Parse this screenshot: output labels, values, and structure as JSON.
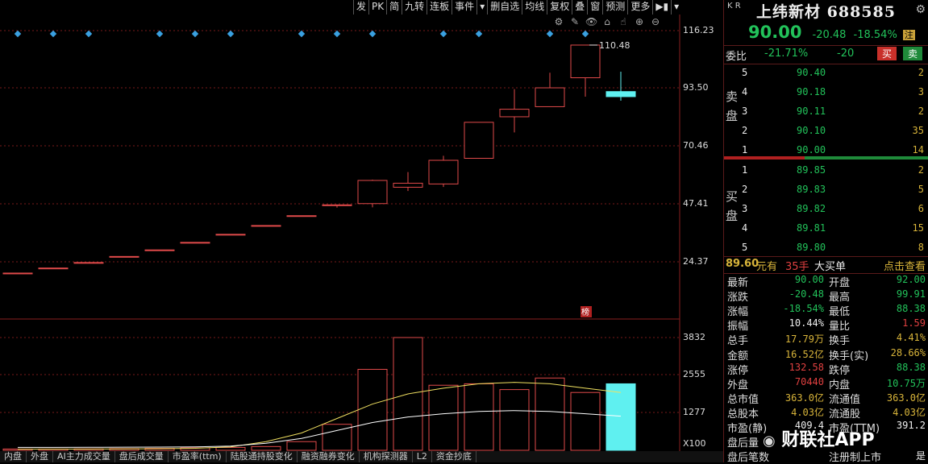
{
  "toolbar": [
    "发",
    "PK",
    "简",
    "九转",
    "连板",
    "事件",
    "▾",
    "删自选",
    "均线",
    "复权",
    "叠",
    "窗",
    "预测",
    "更多",
    "▶▮",
    "▾"
  ],
  "chart_icons": [
    "⚙",
    "✎",
    "👁",
    "⌂",
    "☝",
    "⊕",
    "⊖"
  ],
  "chart_data": {
    "type": "candlestick",
    "y_ticks_price": [
      "116.23",
      "93.50",
      "70.46",
      "47.41",
      "24.37"
    ],
    "y_ticks_volume": [
      "3832",
      "2555",
      "1277",
      "X100"
    ],
    "high_annotation": "110.48",
    "rank_badge": "榜",
    "candles": [
      {
        "o": 19.9,
        "c": 19.9,
        "h": 19.9,
        "l": 19.9
      },
      {
        "o": 21.9,
        "c": 21.9,
        "h": 21.9,
        "l": 21.9
      },
      {
        "o": 24.1,
        "c": 24.1,
        "h": 24.1,
        "l": 24.1
      },
      {
        "o": 26.5,
        "c": 26.5,
        "h": 26.5,
        "l": 26.5
      },
      {
        "o": 29.1,
        "c": 29.1,
        "h": 29.1,
        "l": 29.1
      },
      {
        "o": 32.1,
        "c": 32.1,
        "h": 32.1,
        "l": 32.1
      },
      {
        "o": 35.3,
        "c": 35.3,
        "h": 35.3,
        "l": 35.3
      },
      {
        "o": 38.8,
        "c": 38.8,
        "h": 38.8,
        "l": 38.8
      },
      {
        "o": 42.7,
        "c": 42.7,
        "h": 42.7,
        "l": 42.7
      },
      {
        "o": 46.9,
        "c": 47.0,
        "h": 47.0,
        "l": 45.9
      },
      {
        "o": 47.5,
        "c": 56.7,
        "h": 57.0,
        "l": 46.0
      },
      {
        "o": 54.0,
        "c": 55.6,
        "h": 60.0,
        "l": 52.5
      },
      {
        "o": 55.3,
        "c": 64.7,
        "h": 66.5,
        "l": 54.1
      },
      {
        "o": 65.5,
        "c": 79.8,
        "h": 79.8,
        "l": 65.5
      },
      {
        "o": 82.0,
        "c": 85.0,
        "h": 93.0,
        "l": 75.8
      },
      {
        "o": 86.0,
        "c": 93.5,
        "h": 99.5,
        "l": 86.0
      },
      {
        "o": 97.5,
        "c": 110.48,
        "h": 110.48,
        "l": 90.0
      },
      {
        "o": 92.0,
        "c": 90.0,
        "h": 99.91,
        "l": 88.38
      }
    ],
    "volumes": [
      45,
      45,
      50,
      60,
      70,
      85,
      100,
      130,
      300,
      900,
      2800,
      3900,
      2250,
      2300,
      2100,
      2500,
      2000,
      2300,
      1750
    ],
    "volume_ma": [
      40,
      41,
      43,
      48,
      55,
      70,
      120,
      300,
      600,
      1100,
      1600,
      1950,
      2150,
      2300,
      2350,
      2300,
      2150,
      2000,
      1900
    ]
  },
  "stock": {
    "kr_label": "K R",
    "name": "上纬新材",
    "code": "688585",
    "price": "90.00",
    "change": "-20.48",
    "pct": "-18.54%",
    "badge": "注",
    "weibi_label": "委比",
    "weibi_pct": "-21.71%",
    "weibi_diff": "-20",
    "buy_btn": "买",
    "sell_btn": "卖"
  },
  "sell_label": "卖盘",
  "buy_label": "买盘",
  "asks": [
    {
      "lv": "5",
      "price": "90.40",
      "vol": "2"
    },
    {
      "lv": "4",
      "price": "90.18",
      "vol": "3"
    },
    {
      "lv": "3",
      "price": "90.11",
      "vol": "2"
    },
    {
      "lv": "2",
      "price": "90.10",
      "vol": "35"
    },
    {
      "lv": "1",
      "price": "90.00",
      "vol": "14"
    }
  ],
  "bids": [
    {
      "lv": "1",
      "price": "89.85",
      "vol": "2"
    },
    {
      "lv": "2",
      "price": "89.83",
      "vol": "5"
    },
    {
      "lv": "3",
      "price": "89.82",
      "vol": "6"
    },
    {
      "lv": "4",
      "price": "89.81",
      "vol": "15"
    },
    {
      "lv": "5",
      "price": "89.80",
      "vol": "8"
    }
  ],
  "last_deal": {
    "price": "89.60",
    "unit": "元有",
    "qty": "35手",
    "label": "大买单",
    "link": "点击查看"
  },
  "stats": [
    {
      "l": "最新",
      "v": "90.00",
      "vc": "#22c25a",
      "l2": "开盘",
      "v2": "92.00",
      "v2c": "#22c25a"
    },
    {
      "l": "涨跌",
      "v": "-20.48",
      "vc": "#22c25a",
      "l2": "最高",
      "v2": "99.91",
      "v2c": "#22c25a"
    },
    {
      "l": "涨幅",
      "v": "-18.54%",
      "vc": "#22c25a",
      "l2": "最低",
      "v2": "88.38",
      "v2c": "#22c25a"
    },
    {
      "l": "振幅",
      "v": "10.44%",
      "vc": "#eee",
      "l2": "量比",
      "v2": "1.59",
      "v2c": "#e04040"
    },
    {
      "l": "总手",
      "v": "17.79万",
      "vc": "#d8b43a",
      "l2": "换手",
      "v2": "4.41%",
      "v2c": "#d8b43a"
    },
    {
      "l": "金额",
      "v": "16.52亿",
      "vc": "#d8b43a",
      "l2": "换手(实)",
      "v2": "28.66%",
      "v2c": "#d8b43a"
    },
    {
      "l": "涨停",
      "v": "132.58",
      "vc": "#e04040",
      "l2": "跌停",
      "v2": "88.38",
      "v2c": "#22c25a"
    },
    {
      "l": "外盘",
      "v": "70440",
      "vc": "#e04040",
      "l2": "内盘",
      "v2": "10.75万",
      "v2c": "#22c25a"
    },
    {
      "l": "总市值",
      "v": "363.0亿",
      "vc": "#d8b43a",
      "l2": "流通值",
      "v2": "363.0亿",
      "v2c": "#d8b43a"
    },
    {
      "l": "总股本",
      "v": "4.03亿",
      "vc": "#d8b43a",
      "l2": "流通股",
      "v2": "4.03亿",
      "v2c": "#d8b43a"
    },
    {
      "l": "市盈(静)",
      "v": "409.4",
      "vc": "#eee",
      "l2": "市盈(TTM)",
      "v2": "391.2",
      "v2c": "#eee"
    },
    {
      "l": "盘后量",
      "v": "",
      "vc": "#eee",
      "l2": "",
      "v2": "",
      "v2c": "#eee"
    },
    {
      "l": "盘后笔数",
      "v": "",
      "vc": "#eee",
      "l2": "注册制上市",
      "v2": "是",
      "v2c": "#eee"
    }
  ],
  "bottom_tabs": [
    "内盘",
    "外盘",
    "AI主力成交量",
    "盘后成交量",
    "市盈率(ttm)",
    "陆股通持股变化",
    "融资融券变化",
    "机构探测器",
    "L2",
    "资金抄底"
  ],
  "watermark": "财联社APP"
}
